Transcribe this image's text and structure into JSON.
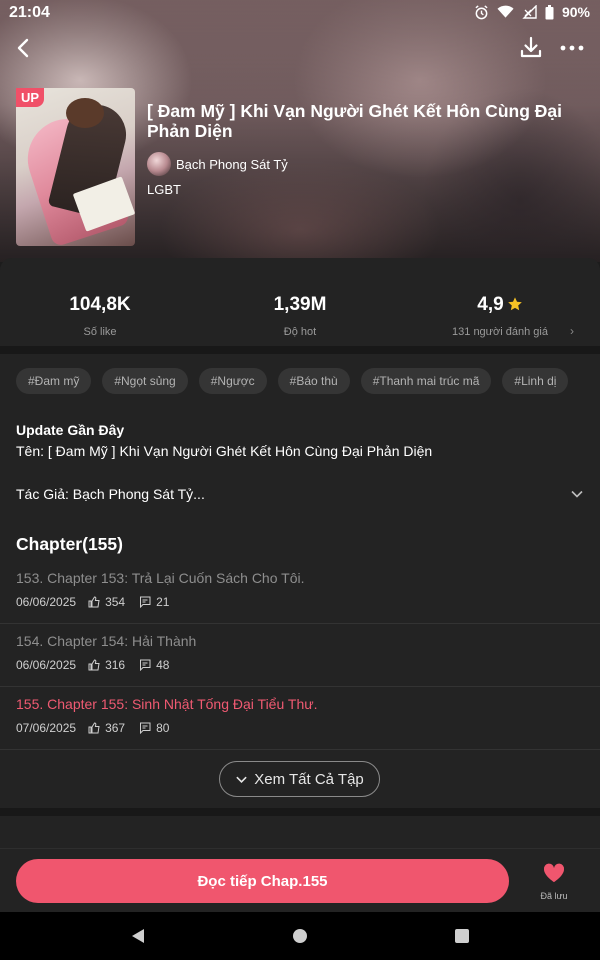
{
  "status_bar": {
    "time": "21:04",
    "battery": "90%"
  },
  "header": {
    "up_badge": "UP",
    "title": "[ Đam Mỹ ] Khi Vạn Người Ghét Kết Hôn Cùng Đại Phản Diện",
    "author": "Bạch Phong Sát Tỷ",
    "genre": "LGBT"
  },
  "stats": {
    "likes": {
      "value": "104,8K",
      "label": "Số like"
    },
    "hot": {
      "value": "1,39M",
      "label": "Độ hot"
    },
    "rating": {
      "value": "4,9",
      "label": "131 người đánh giá"
    }
  },
  "tags": [
    "#Đam mỹ",
    "#Ngọt sủng",
    "#Ngược",
    "#Báo thù",
    "#Thanh mai trúc mã",
    "#Linh dị"
  ],
  "description": {
    "title": "Update Gần Đây",
    "line1": "Tên: [ Đam Mỹ ] Khi Vạn Người Ghét Kết Hôn Cùng Đại Phản Diện",
    "line2": "Tác Giả: Bạch Phong Sát Tỷ..."
  },
  "chapters": {
    "heading": "Chapter(155)",
    "items": [
      {
        "title": "153. Chapter 153: Trả Lại Cuốn Sách Cho Tôi.",
        "date": "06/06/2025",
        "likes": "354",
        "comments": "21",
        "active": false
      },
      {
        "title": "154. Chapter 154: Hải Thành",
        "date": "06/06/2025",
        "likes": "316",
        "comments": "48",
        "active": false
      },
      {
        "title": "155. Chapter 155: Sinh Nhật Tống Đại Tiểu Thư.",
        "date": "07/06/2025",
        "likes": "367",
        "comments": "80",
        "active": true
      }
    ],
    "see_all": "Xem Tất Cả Tập"
  },
  "bottom": {
    "continue_label": "Đọc tiếp Chap.155",
    "saved_label": "Đã lưu"
  },
  "colors": {
    "accent": "#f0566e",
    "panel": "#232323",
    "divider": "#181818"
  },
  "icons": [
    "back-arrow-icon",
    "download-icon",
    "more-icon",
    "star-icon",
    "chevron-down-icon",
    "thumbs-up-icon",
    "comment-icon",
    "heart-icon"
  ]
}
